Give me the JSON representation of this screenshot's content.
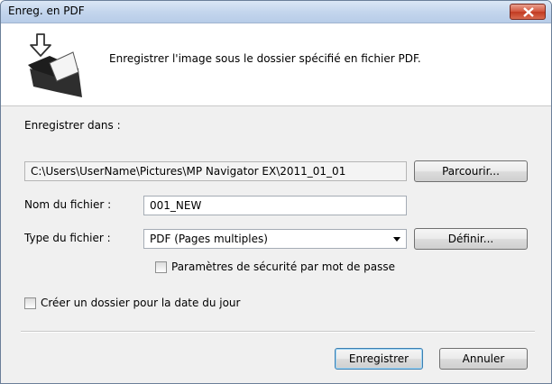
{
  "window": {
    "title": "Enreg. en PDF"
  },
  "header": {
    "description": "Enregistrer l'image sous le dossier spécifié en fichier PDF.",
    "icon": "folder-save-icon"
  },
  "save_in": {
    "label": "Enregistrer dans :",
    "path": "C:\\Users\\UserName\\Pictures\\MP Navigator EX\\2011_01_01",
    "browse_label": "Parcourir..."
  },
  "file_name": {
    "label": "Nom du fichier :",
    "value": "001_NEW"
  },
  "file_type": {
    "label": "Type du fichier :",
    "selected": "PDF (Pages multiples)",
    "define_label": "Définir..."
  },
  "password_security": {
    "label": "Paramètres de sécurité par mot de passe",
    "checked": false
  },
  "date_folder": {
    "label": "Créer un dossier pour la date du jour",
    "checked": false
  },
  "footer": {
    "save_label": "Enregistrer",
    "cancel_label": "Annuler"
  },
  "colors": {
    "close": "#c23a22",
    "titlebar": "#c4d6ed",
    "default_border": "#3c7fb1"
  }
}
